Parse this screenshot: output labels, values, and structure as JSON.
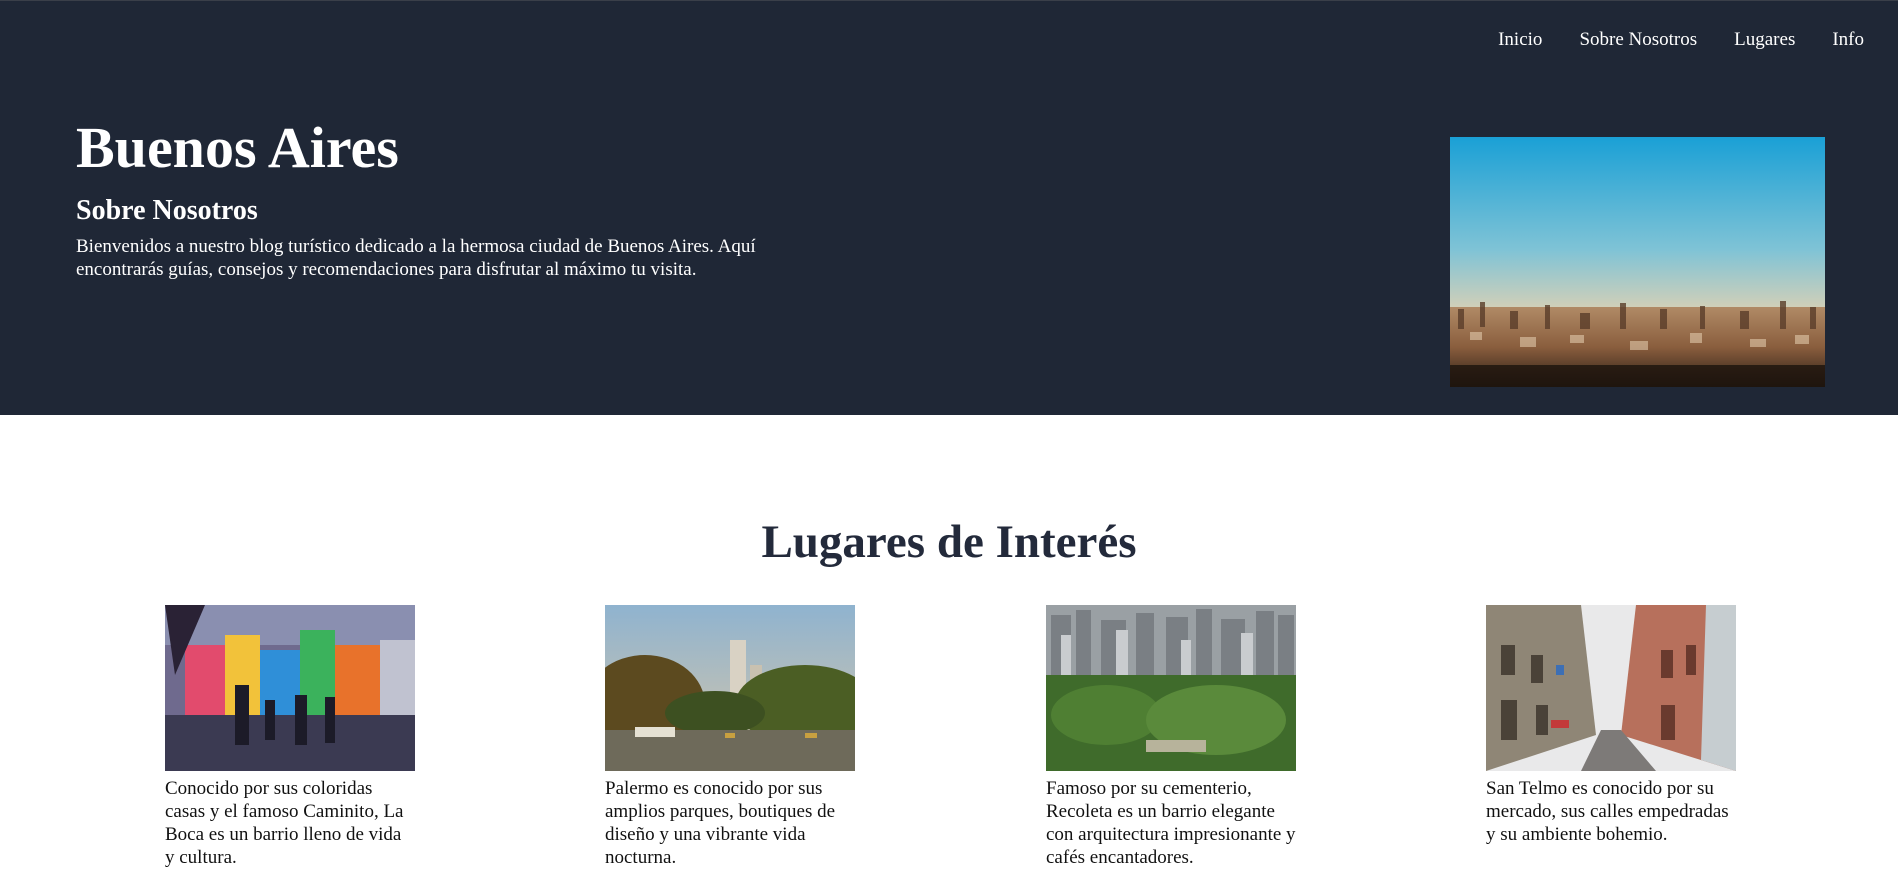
{
  "nav": {
    "items": [
      {
        "label": "Inicio"
      },
      {
        "label": "Sobre Nosotros"
      },
      {
        "label": "Lugares"
      },
      {
        "label": "Info"
      }
    ]
  },
  "hero": {
    "title": "Buenos Aires",
    "about_title": "Sobre Nosotros",
    "about_text": "Bienvenidos a nuestro blog turístico dedicado a la hermosa ciudad de Buenos Aires. Aquí encontrarás guías, consejos y recomendaciones para disfrutar al máximo tu visita."
  },
  "places": {
    "title": "Lugares de Interés",
    "cards": [
      {
        "text": "Conocido por sus coloridas casas y el famoso Caminito, La Boca es un barrio lleno de vida y cultura."
      },
      {
        "text": "Palermo es conocido por sus amplios parques, boutiques de diseño y una vibrante vida nocturna."
      },
      {
        "text": "Famoso por su cementerio, Recoleta es un barrio elegante con arquitectura impresionante y cafés encantadores."
      },
      {
        "text": "San Telmo es conocido por su mercado, sus calles empedradas y su ambiente bohemio."
      }
    ]
  },
  "colors": {
    "header_bg": "#1f2736",
    "heading_dark": "#232a3b",
    "text_light": "#ffffff"
  }
}
